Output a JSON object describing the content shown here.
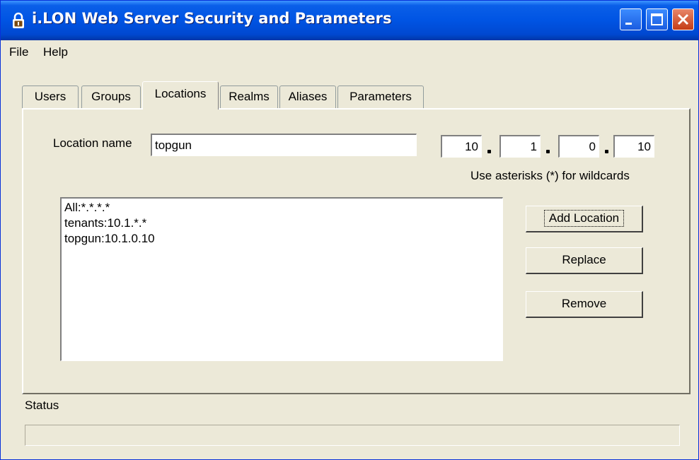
{
  "window": {
    "title": "i.LON Web Server Security and Parameters"
  },
  "menu": {
    "file": "File",
    "help": "Help"
  },
  "tabs": [
    {
      "label": "Users"
    },
    {
      "label": "Groups"
    },
    {
      "label": "Locations",
      "active": true
    },
    {
      "label": "Realms"
    },
    {
      "label": "Aliases"
    },
    {
      "label": "Parameters"
    }
  ],
  "location": {
    "name_label": "Location name",
    "name_value": "topgun",
    "ip": [
      "10",
      "1",
      "0",
      "10"
    ],
    "wildcard_hint": "Use asterisks (*) for wildcards"
  },
  "locations_list": [
    "All:*.*.*.*",
    "tenants:10.1.*.*",
    "topgun:10.1.0.10"
  ],
  "buttons": {
    "add": "Add Location",
    "replace": "Replace",
    "remove": "Remove"
  },
  "status": {
    "label": "Status",
    "text": ""
  },
  "colors": {
    "titlebar": "#0054e3",
    "window_bg": "#ece9d8",
    "close": "#c43c16"
  }
}
